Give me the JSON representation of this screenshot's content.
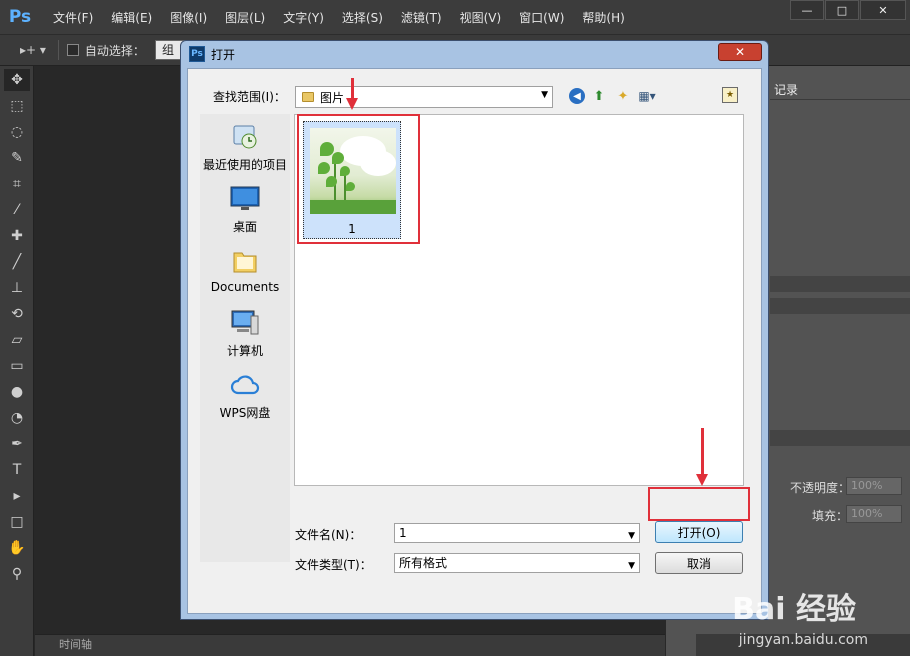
{
  "app": {
    "logo": "Ps",
    "menu": [
      "文件(F)",
      "编辑(E)",
      "图像(I)",
      "图层(L)",
      "文字(Y)",
      "选择(S)",
      "滤镜(T)",
      "视图(V)",
      "窗口(W)",
      "帮助(H)"
    ],
    "window_controls": {
      "minimize": "—",
      "maximize": "□",
      "close": "✕"
    }
  },
  "options_bar": {
    "tool_glyph": "▸+ ▾",
    "auto_select_label": "自动选择：",
    "auto_select_value": "组"
  },
  "tools": [
    "move",
    "marquee",
    "lasso",
    "quick-select",
    "crop",
    "eyedropper",
    "healing",
    "brush",
    "stamp",
    "history-brush",
    "eraser",
    "gradient",
    "blur",
    "dodge",
    "pen",
    "type",
    "path-select",
    "shape",
    "hand",
    "zoom"
  ],
  "timeline": {
    "label": "时间轴"
  },
  "right_panel": {
    "history_tab": "记录",
    "opacity_label": "不透明度：",
    "opacity_value": "100%",
    "fill_label": "填充：",
    "fill_value": "100%"
  },
  "dialog": {
    "title": "打开",
    "title_icon": "Ps",
    "close_glyph": "✕",
    "look_in_label": "查找范围(I)：",
    "look_in_value": "图片",
    "places": [
      {
        "label": "最近使用的项目",
        "icon": "recent-icon"
      },
      {
        "label": "桌面",
        "icon": "desktop-icon"
      },
      {
        "label": "Documents",
        "icon": "folder-icon"
      },
      {
        "label": "计算机",
        "icon": "computer-icon"
      },
      {
        "label": "WPS网盘",
        "icon": "cloud-icon"
      }
    ],
    "files": [
      {
        "name": "1"
      }
    ],
    "file_name_label": "文件名(N)：",
    "file_name_value": "1",
    "file_type_label": "文件类型(T)：",
    "file_type_value": "所有格式",
    "open_button": "打开(O)",
    "cancel_button": "取消"
  },
  "watermark": {
    "brand": "Bai 经验",
    "url": "jingyan.baidu.com"
  },
  "colors": {
    "annotation_red": "#e0303a",
    "ps_blue": "#5db2ff",
    "selection_blue": "#cde2fb"
  }
}
